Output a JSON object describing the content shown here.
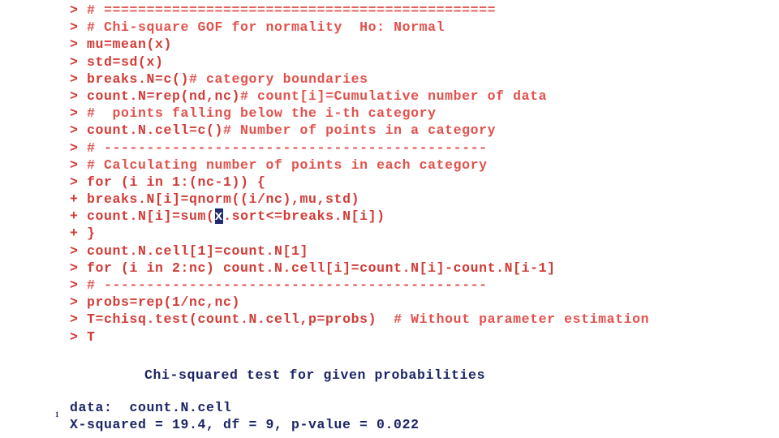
{
  "slide": {
    "page_number": "1",
    "background_color": "#ffffff",
    "code_color": "#d23b36",
    "comment_color": "#e2514c",
    "output_color": "#1c2466",
    "selection_bg": "#1f2a6e",
    "selection_fg": "#ffffff"
  },
  "console": {
    "lines": [
      {
        "prompt": "> ",
        "code": "",
        "comment": "# =============================================="
      },
      {
        "prompt": "> ",
        "code": "",
        "comment": "# Chi-square GOF for normality  Ho: Normal"
      },
      {
        "prompt": "> ",
        "code": "mu=mean(x)",
        "comment": ""
      },
      {
        "prompt": "> ",
        "code": "std=sd(x)",
        "comment": ""
      },
      {
        "prompt": "> ",
        "code": "breaks.N=c()",
        "comment": "# category boundaries"
      },
      {
        "prompt": "> ",
        "code": "count.N=rep(nd,nc)",
        "comment": "# count[i]=Cumulative number of data"
      },
      {
        "prompt": "> ",
        "code": "",
        "comment": "#  points falling below the i-th category"
      },
      {
        "prompt": "> ",
        "code": "count.N.cell=c()",
        "comment": "# Number of points in a category"
      },
      {
        "prompt": "> ",
        "code": "",
        "comment": "# ---------------------------------------------"
      },
      {
        "prompt": "> ",
        "code": "",
        "comment": "# Calculating number of points in each category"
      },
      {
        "prompt": "> ",
        "code": "for (i in 1:(nc-1)) {",
        "comment": ""
      },
      {
        "prompt": "+ ",
        "code": "breaks.N[i]=qnorm((i/nc),mu,std)",
        "comment": ""
      },
      {
        "prompt": "+ ",
        "code": "count.N[i]=sum(",
        "selection": "x",
        "code_after": ".sort<=breaks.N[i])",
        "comment": ""
      },
      {
        "prompt": "+ ",
        "code": "}",
        "comment": ""
      },
      {
        "prompt": "> ",
        "code": "count.N.cell[1]=count.N[1]",
        "comment": ""
      },
      {
        "prompt": "> ",
        "code": "for (i in 2:nc) count.N.cell[i]=count.N[i]-count.N[i-1]",
        "comment": ""
      },
      {
        "prompt": "> ",
        "code": "",
        "comment": "# ---------------------------------------------"
      },
      {
        "prompt": "> ",
        "code": "probs=rep(1/nc,nc)",
        "comment": ""
      },
      {
        "prompt": "> ",
        "code": "T=chisq.test(count.N.cell,p=probs)  ",
        "comment": "# Without parameter estimation"
      },
      {
        "prompt": "> ",
        "code": "T",
        "comment": ""
      }
    ]
  },
  "output": {
    "title": "Chi-squared test for given probabilities",
    "data_line": "data:  count.N.cell",
    "stats_line": "X-squared = 19.4, df = 9, p-value = 0.022"
  }
}
